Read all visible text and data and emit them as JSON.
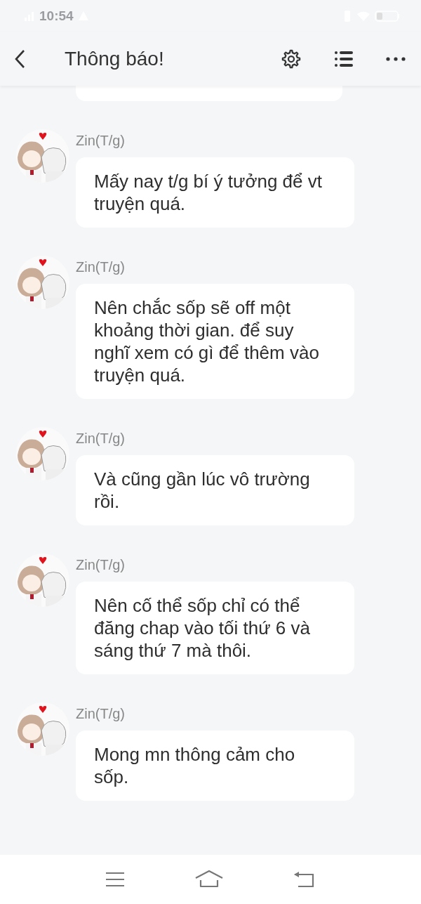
{
  "status_bar": {
    "time": "10:54"
  },
  "header": {
    "title": "Thông báo!"
  },
  "messages": [
    {
      "author": "Zin(T/g)",
      "text": "Mấy nay t/g bí ý tưởng để vt truyện quá."
    },
    {
      "author": "Zin(T/g)",
      "text": "Nên chắc sốp sẽ off một khoảng thời gian. để suy nghĩ xem có gì để thêm vào truyện quá."
    },
    {
      "author": "Zin(T/g)",
      "text": "Và cũng gần lúc vô trường rồi."
    },
    {
      "author": "Zin(T/g)",
      "text": "Nên cố thể sốp chỉ có thể đăng chap vào tối thứ 6 và sáng thứ 7 mà thôi."
    },
    {
      "author": "Zin(T/g)",
      "text": "Mong mn thông cảm cho sốp."
    }
  ]
}
